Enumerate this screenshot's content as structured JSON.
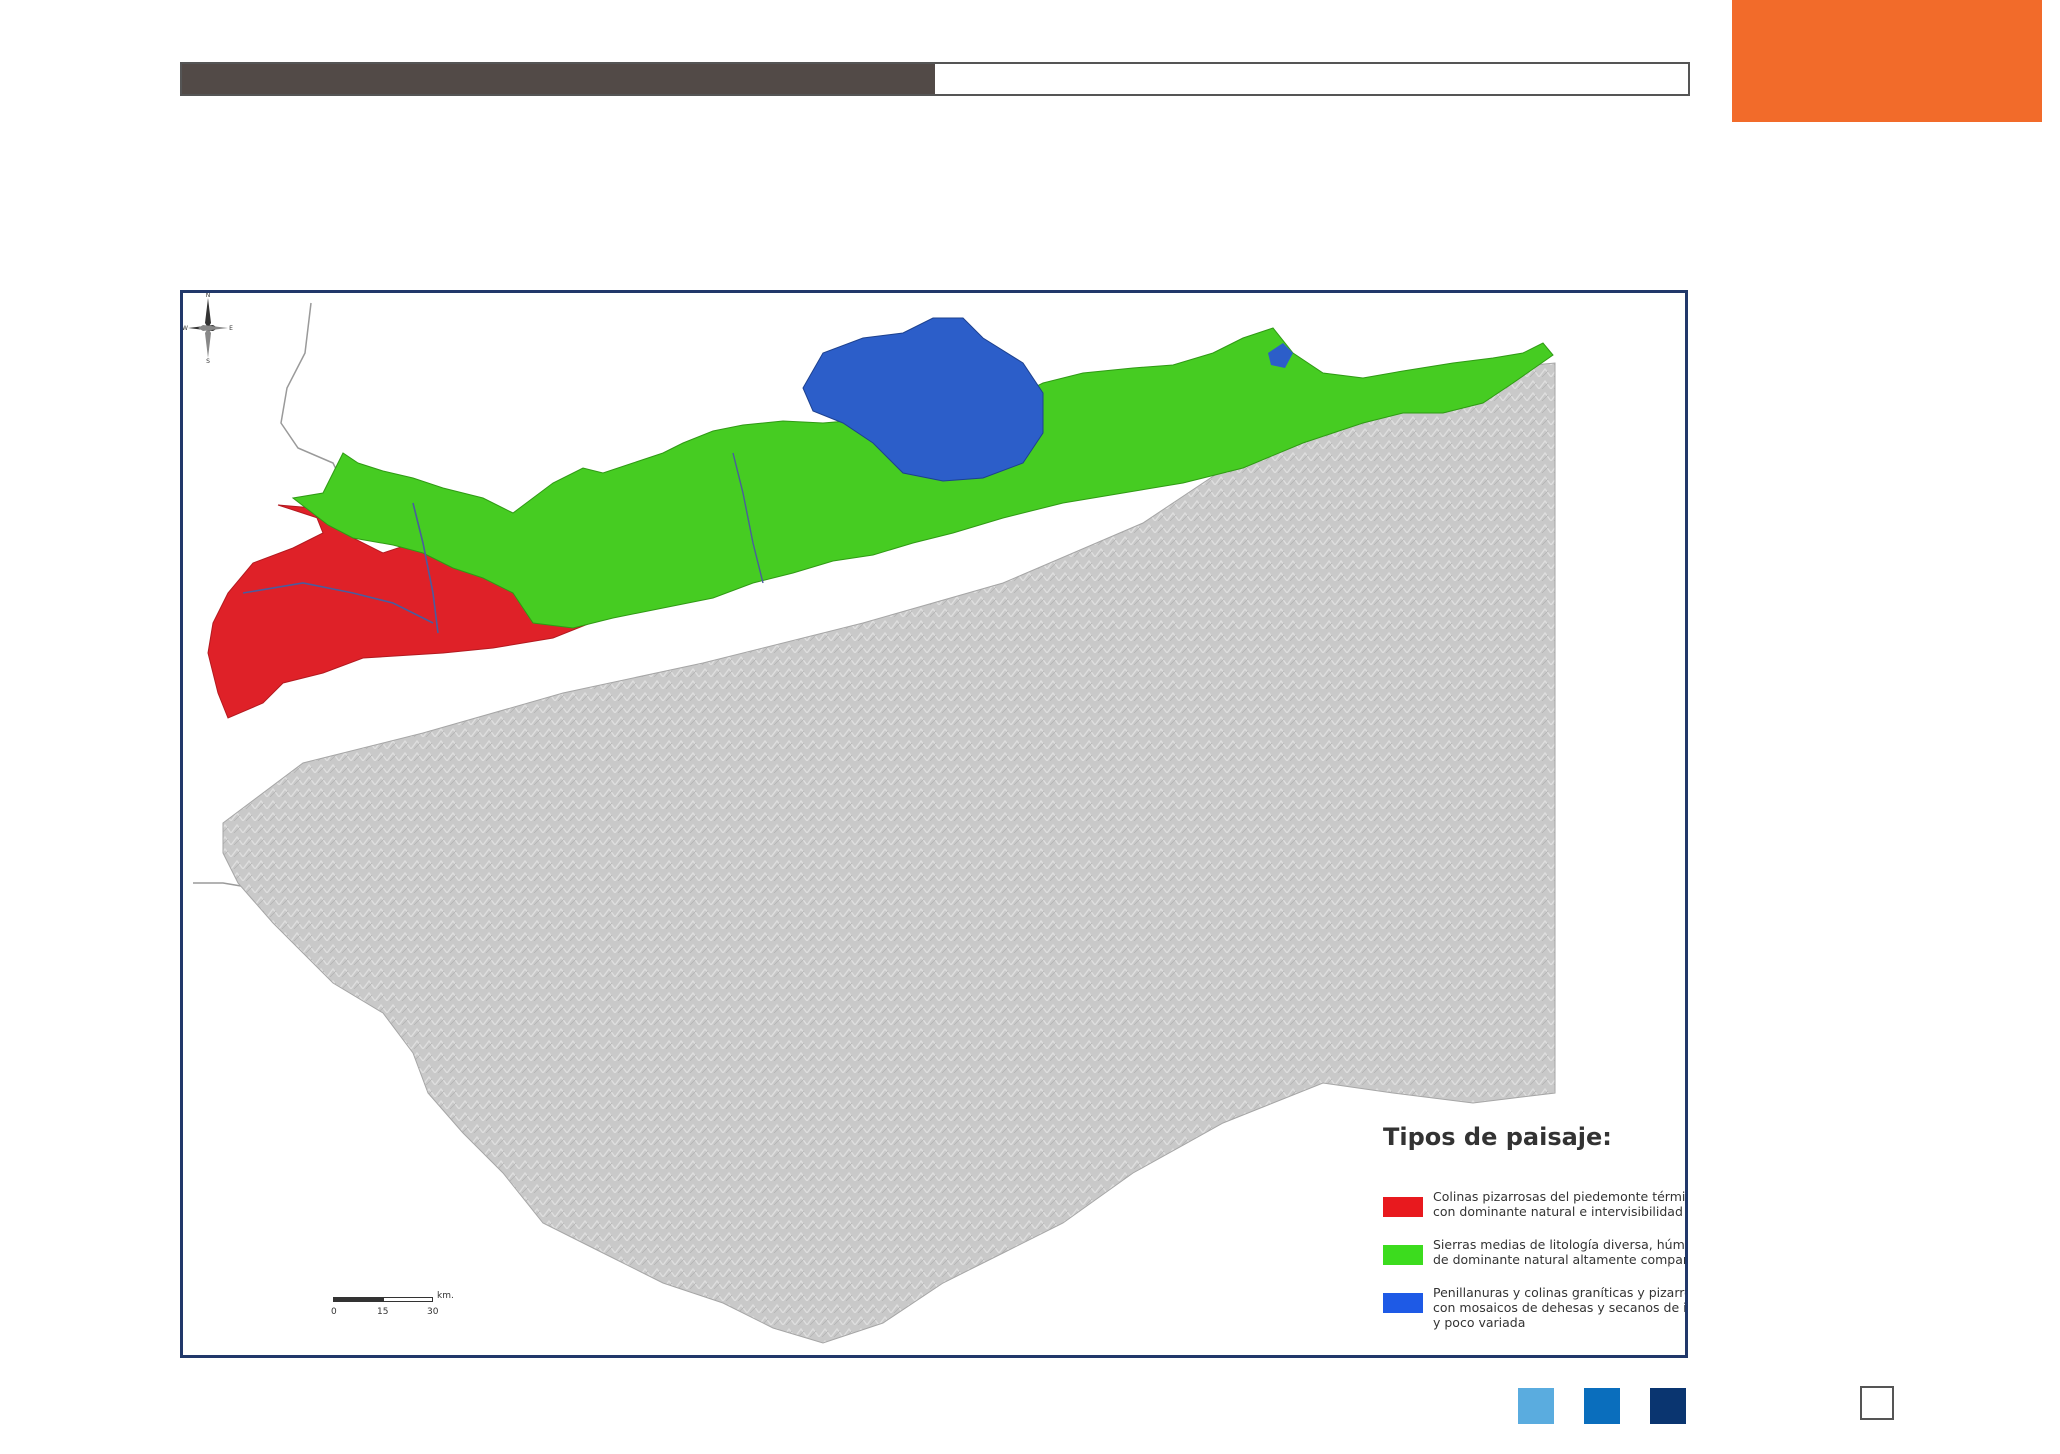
{
  "header": {
    "progress": 0.5,
    "bar_color": "#524a47",
    "accent_color": "#f26b2a"
  },
  "map": {
    "legend": {
      "title": "Tipos de paisaje:",
      "items": [
        {
          "color": "#e8191e",
          "text": "Colinas pizarrosas del piedemonte térmico occidental\ncon dominante natural e intervisibilidad heterogénea"
        },
        {
          "color": "#3cdc1e",
          "text": "Sierras medias de litología diversa, húmedas y subhúmedas,\nde dominante natural altamente compartimentadas"
        },
        {
          "color": "#1e5ae6",
          "text": "Penillanuras y colinas graníticas y pizarrosas semicontinentales\ncon mosaicos de dehesas y secanos de intervisibilidad escasa\ny poco variada"
        }
      ]
    },
    "scale": {
      "labels": [
        "0",
        "15",
        "30"
      ],
      "unit": "km."
    },
    "compass": {
      "n": "N",
      "s": "S",
      "e": "E",
      "w": "W"
    }
  },
  "footer": {
    "nav_colors": [
      "#5aacdf",
      "#0a6ebd",
      "#0a3570"
    ]
  }
}
